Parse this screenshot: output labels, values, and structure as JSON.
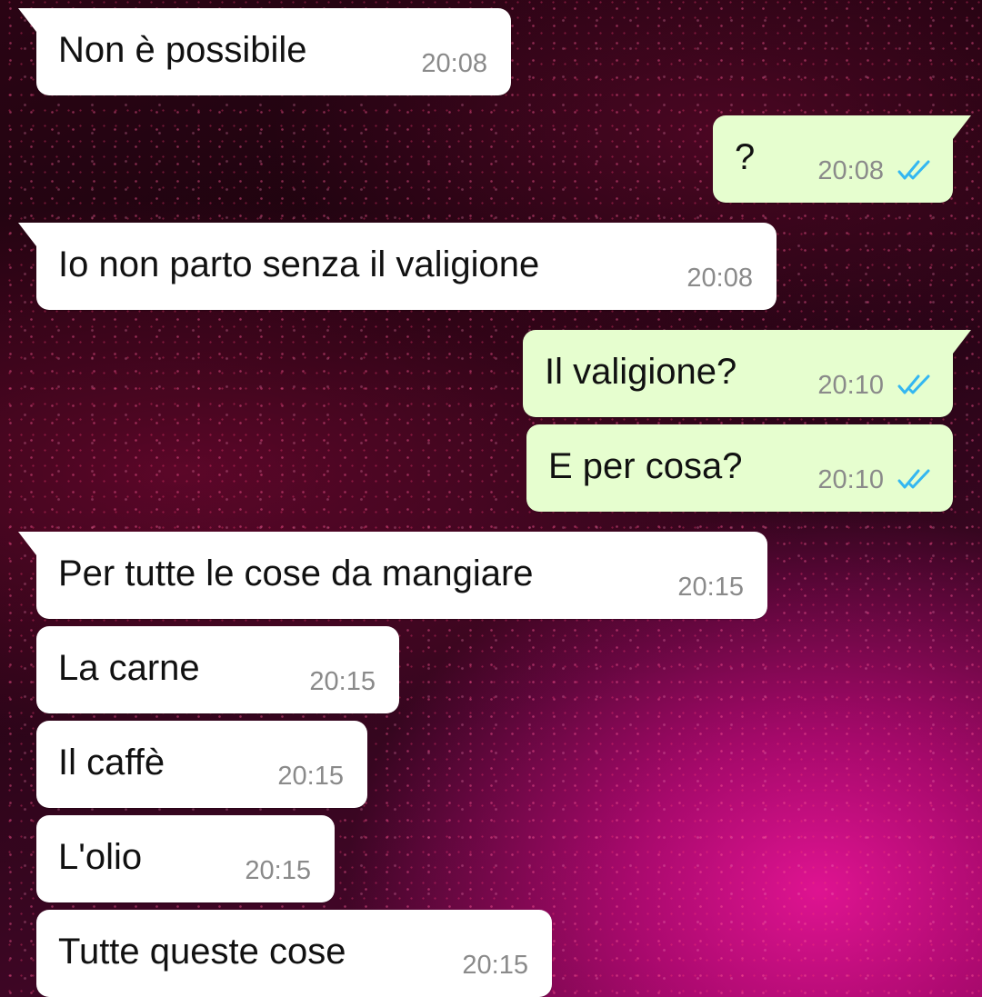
{
  "messages": [
    {
      "direction": "incoming",
      "text": "Non è possibile",
      "time": "20:08"
    },
    {
      "direction": "outgoing",
      "text": "?",
      "time": "20:08",
      "status": "read-double-check-icon"
    },
    {
      "direction": "incoming",
      "text": "Io non parto senza il valigione",
      "time": "20:08"
    },
    {
      "direction": "outgoing",
      "text": "Il valigione?",
      "time": "20:10",
      "status": "read-double-check-icon"
    },
    {
      "direction": "outgoing",
      "text": "E per cosa?",
      "time": "20:10",
      "status": "read-double-check-icon"
    },
    {
      "direction": "incoming",
      "text": "Per tutte le cose da mangiare",
      "time": "20:15"
    },
    {
      "direction": "incoming",
      "text": "La carne",
      "time": "20:15"
    },
    {
      "direction": "incoming",
      "text": "Il caffè",
      "time": "20:15"
    },
    {
      "direction": "incoming",
      "text": "L'olio",
      "time": "20:15"
    },
    {
      "direction": "incoming",
      "text": "Tutte queste cose",
      "time": "20:15"
    }
  ],
  "colors": {
    "incoming_bubble": "#ffffff",
    "outgoing_bubble": "#e6fecf",
    "read_check": "#34b7f1",
    "timestamp": "#8a8a8a"
  }
}
